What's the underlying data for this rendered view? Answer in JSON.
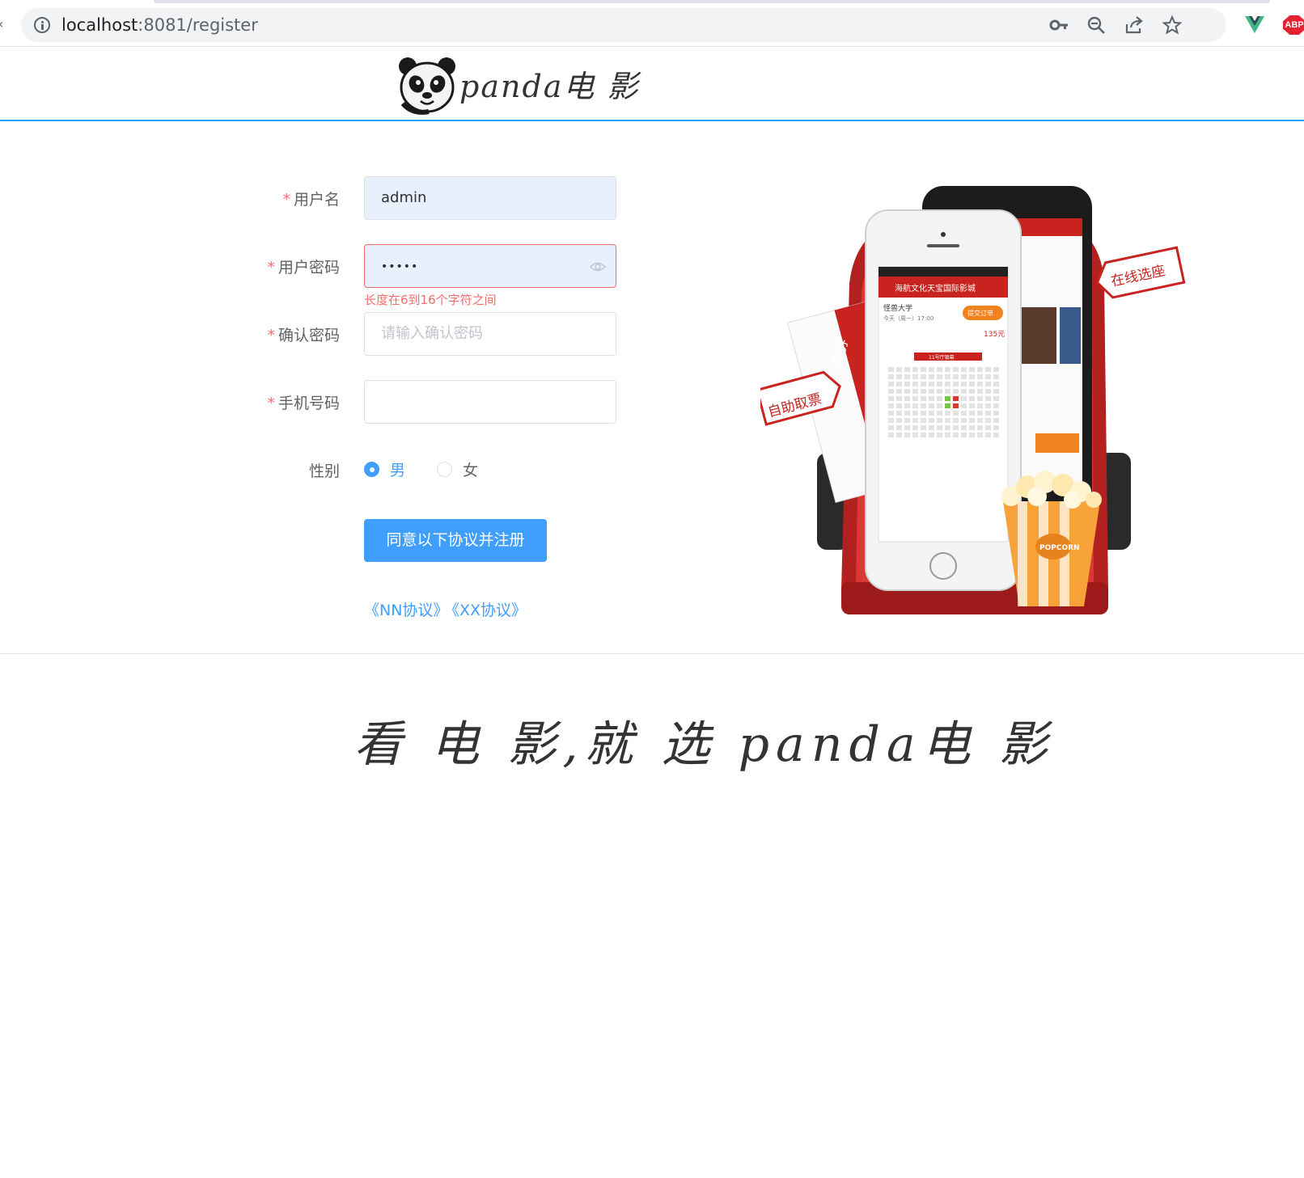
{
  "browser": {
    "url_host": "localhost",
    "url_path": ":8081/register",
    "icons": [
      "info-icon",
      "key-icon",
      "zoom-icon",
      "share-icon",
      "star-icon",
      "vue-devtools-icon",
      "adblock-icon"
    ],
    "abp_label": "ABP"
  },
  "header": {
    "logo_text": "panda电 影"
  },
  "form": {
    "username": {
      "label": "用户名",
      "value": "admin"
    },
    "password": {
      "label": "用户密码",
      "value": "•••••",
      "error": "长度在6到16个字符之间"
    },
    "confirm": {
      "label": "确认密码",
      "placeholder": "请输入确认密码"
    },
    "phone": {
      "label": "手机号码",
      "value": ""
    },
    "gender": {
      "label": "性别",
      "options": [
        "男",
        "女"
      ],
      "selected": "男"
    },
    "submit_label": "同意以下协议并注册",
    "agreements": [
      "《NN协议》",
      "《XX协议》"
    ],
    "required_mark": "*"
  },
  "promo": {
    "tag_left": "自助取票",
    "tag_right": "在线选座",
    "phone_title": "海航文化天宝国际影城",
    "cinema_name": "怪兽大学",
    "show_time": "今天（周一）17:00",
    "order_button": "提交订单",
    "price": "135元",
    "screen_label": "11号厅银幕",
    "ticket_label": "副券",
    "popcorn_label": "POPCORN"
  },
  "footer": {
    "slogan": "看 电 影,就 选 panda电 影"
  },
  "colors": {
    "primary": "#409eff",
    "danger": "#f56c6c",
    "header_rule": "#20a0ff"
  }
}
